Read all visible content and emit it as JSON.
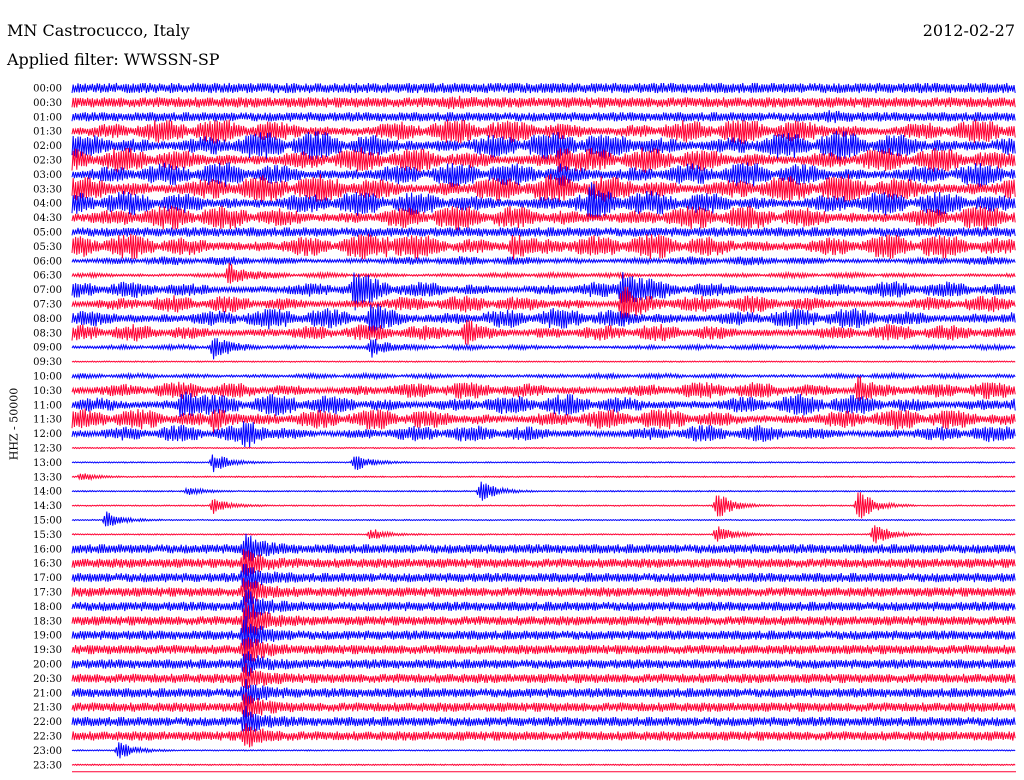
{
  "header": {
    "station": "MN Castrocucco, Italy",
    "date": "2012-02-27",
    "filter": "Applied filter: WWSSN-SP"
  },
  "chart_data": {
    "type": "line",
    "title": "MN Castrocucco, Italy",
    "date": "2012-02-27",
    "filter_label": "Applied filter: WWSSN-SP",
    "ylabel": "HHZ - 50000",
    "rows": [
      "00:00",
      "00:30",
      "01:00",
      "01:30",
      "02:00",
      "02:30",
      "03:00",
      "03:30",
      "04:00",
      "04:30",
      "05:00",
      "05:30",
      "06:00",
      "06:30",
      "07:00",
      "07:30",
      "08:00",
      "08:30",
      "09:00",
      "09:30",
      "10:00",
      "10:30",
      "11:00",
      "11:30",
      "12:00",
      "12:30",
      "13:00",
      "13:30",
      "14:00",
      "14:30",
      "15:00",
      "15:30",
      "16:00",
      "16:30",
      "17:00",
      "17:30",
      "18:00",
      "18:30",
      "19:00",
      "19:30",
      "20:00",
      "20:30",
      "21:00",
      "21:30",
      "22:00",
      "22:30",
      "23:00",
      "23:30"
    ],
    "trace_colors": [
      "#0000ff",
      "#ff0033"
    ],
    "axis_color": "#ff0033",
    "activity_levels": [
      9,
      9,
      8,
      6,
      7,
      6,
      6,
      7,
      6,
      6,
      8,
      6,
      2,
      1,
      4,
      4,
      5,
      4,
      1,
      0,
      1,
      4,
      5,
      5,
      4,
      0,
      0,
      0,
      0,
      0,
      0,
      0,
      8,
      8,
      8,
      8,
      8,
      8,
      8,
      8,
      8,
      8,
      8,
      8,
      8,
      8,
      0,
      0
    ],
    "events": [
      {
        "row": "00:30",
        "minute": 12.0,
        "amp": 3
      },
      {
        "row": "01:00",
        "minute": 24.0,
        "amp": 3
      },
      {
        "row": "02:30",
        "minute": 15.5,
        "amp": 12
      },
      {
        "row": "03:00",
        "minute": 15.5,
        "amp": 6
      },
      {
        "row": "04:00",
        "minute": 16.5,
        "amp": 10
      },
      {
        "row": "05:30",
        "minute": 14.0,
        "amp": 12
      },
      {
        "row": "05:30",
        "minute": 10.0,
        "amp": 5
      },
      {
        "row": "06:30",
        "minute": 5.0,
        "amp": 12
      },
      {
        "row": "07:00",
        "minute": 9.0,
        "amp": 14
      },
      {
        "row": "07:00",
        "minute": 17.5,
        "amp": 18
      },
      {
        "row": "07:30",
        "minute": 17.5,
        "amp": 20
      },
      {
        "row": "08:00",
        "minute": 9.5,
        "amp": 14
      },
      {
        "row": "08:30",
        "minute": 12.5,
        "amp": 12
      },
      {
        "row": "09:00",
        "minute": 4.5,
        "amp": 12
      },
      {
        "row": "09:00",
        "minute": 9.5,
        "amp": 10
      },
      {
        "row": "10:30",
        "minute": 25.0,
        "amp": 14
      },
      {
        "row": "11:00",
        "minute": 3.5,
        "amp": 16
      },
      {
        "row": "11:30",
        "minute": 4.5,
        "amp": 12
      },
      {
        "row": "12:00",
        "minute": 5.5,
        "amp": 10
      },
      {
        "row": "13:00",
        "minute": 4.5,
        "amp": 10
      },
      {
        "row": "13:00",
        "minute": 9.0,
        "amp": 9
      },
      {
        "row": "13:30",
        "minute": 0.3,
        "amp": 4
      },
      {
        "row": "14:00",
        "minute": 13.0,
        "amp": 12
      },
      {
        "row": "14:00",
        "minute": 3.7,
        "amp": 4
      },
      {
        "row": "14:30",
        "minute": 4.5,
        "amp": 8
      },
      {
        "row": "14:30",
        "minute": 20.5,
        "amp": 14
      },
      {
        "row": "14:30",
        "minute": 25.0,
        "amp": 18
      },
      {
        "row": "15:00",
        "minute": 1.1,
        "amp": 8
      },
      {
        "row": "15:30",
        "minute": 9.5,
        "amp": 6
      },
      {
        "row": "15:30",
        "minute": 20.5,
        "amp": 10
      },
      {
        "row": "15:30",
        "minute": 25.5,
        "amp": 12
      },
      {
        "row": "16:00",
        "minute": 5.5,
        "amp": 14
      },
      {
        "row": "16:30",
        "minute": 5.5,
        "amp": 14
      },
      {
        "row": "17:00",
        "minute": 5.5,
        "amp": 14
      },
      {
        "row": "17:30",
        "minute": 5.5,
        "amp": 14
      },
      {
        "row": "18:00",
        "minute": 5.5,
        "amp": 16
      },
      {
        "row": "18:30",
        "minute": 5.5,
        "amp": 22
      },
      {
        "row": "19:00",
        "minute": 5.5,
        "amp": 16
      },
      {
        "row": "19:30",
        "minute": 5.5,
        "amp": 14
      },
      {
        "row": "20:00",
        "minute": 5.5,
        "amp": 12
      },
      {
        "row": "20:30",
        "minute": 5.5,
        "amp": 12
      },
      {
        "row": "21:00",
        "minute": 5.5,
        "amp": 12
      },
      {
        "row": "21:30",
        "minute": 5.5,
        "amp": 12
      },
      {
        "row": "22:00",
        "minute": 5.5,
        "amp": 12
      },
      {
        "row": "22:30",
        "minute": 5.5,
        "amp": 10
      },
      {
        "row": "23:00",
        "minute": 1.5,
        "amp": 10
      }
    ]
  }
}
